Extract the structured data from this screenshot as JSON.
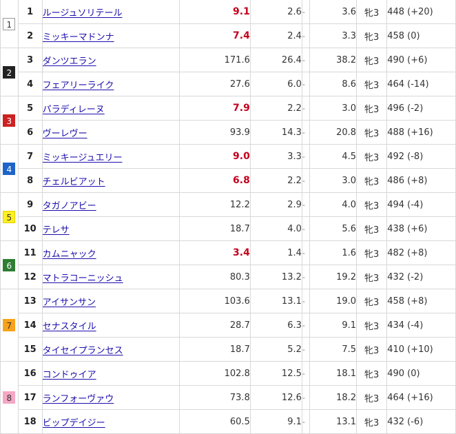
{
  "waku": [
    {
      "label": "1",
      "bg": "#ffffff",
      "fg": "#333333",
      "border": "#999999"
    },
    {
      "label": "2",
      "bg": "#222222",
      "fg": "#ffffff",
      "border": "#222222"
    },
    {
      "label": "3",
      "bg": "#cc2222",
      "fg": "#ffffff",
      "border": "#cc2222"
    },
    {
      "label": "4",
      "bg": "#1e64c8",
      "fg": "#ffffff",
      "border": "#1e64c8"
    },
    {
      "label": "5",
      "bg": "#ffee22",
      "fg": "#333333",
      "border": "#e0d000"
    },
    {
      "label": "6",
      "bg": "#2e7d32",
      "fg": "#ffffff",
      "border": "#2e7d32"
    },
    {
      "label": "7",
      "bg": "#f7a21b",
      "fg": "#333333",
      "border": "#f7a21b"
    },
    {
      "label": "8",
      "bg": "#f5a7c4",
      "fg": "#333333",
      "border": "#f5a7c4"
    }
  ],
  "rows": [
    {
      "umaban": "1",
      "name": "ルージュソリテール",
      "win": "9.1",
      "hot": true,
      "place_low": "2.6",
      "dash": "-",
      "place_high": "3.6",
      "sex_age": "牝3",
      "weight": "448 (+20)"
    },
    {
      "umaban": "2",
      "name": "ミッキーマドンナ",
      "win": "7.4",
      "hot": true,
      "place_low": "2.4",
      "dash": "-",
      "place_high": "3.3",
      "sex_age": "牝3",
      "weight": "458 (0)"
    },
    {
      "umaban": "3",
      "name": "ダンツエラン",
      "win": "171.6",
      "hot": false,
      "place_low": "26.4",
      "dash": "-",
      "place_high": "38.2",
      "sex_age": "牝3",
      "weight": "490 (+6)"
    },
    {
      "umaban": "4",
      "name": "フェアリーライク",
      "win": "27.6",
      "hot": false,
      "place_low": "6.0",
      "dash": "-",
      "place_high": "8.6",
      "sex_age": "牝3",
      "weight": "464 (-14)"
    },
    {
      "umaban": "5",
      "name": "パラディレーヌ",
      "win": "7.9",
      "hot": true,
      "place_low": "2.2",
      "dash": "-",
      "place_high": "3.0",
      "sex_age": "牝3",
      "weight": "496 (-2)"
    },
    {
      "umaban": "6",
      "name": "ヴーレヴー",
      "win": "93.9",
      "hot": false,
      "place_low": "14.3",
      "dash": "-",
      "place_high": "20.8",
      "sex_age": "牝3",
      "weight": "488 (+16)"
    },
    {
      "umaban": "7",
      "name": "ミッキージュエリー",
      "win": "9.0",
      "hot": true,
      "place_low": "3.3",
      "dash": "-",
      "place_high": "4.5",
      "sex_age": "牝3",
      "weight": "492 (-8)"
    },
    {
      "umaban": "8",
      "name": "チェルビアット",
      "win": "6.8",
      "hot": true,
      "place_low": "2.2",
      "dash": "-",
      "place_high": "3.0",
      "sex_age": "牝3",
      "weight": "486 (+8)"
    },
    {
      "umaban": "9",
      "name": "タガノアビー",
      "win": "12.2",
      "hot": false,
      "place_low": "2.9",
      "dash": "-",
      "place_high": "4.0",
      "sex_age": "牝3",
      "weight": "494 (-4)"
    },
    {
      "umaban": "10",
      "name": "テレサ",
      "win": "18.7",
      "hot": false,
      "place_low": "4.0",
      "dash": "-",
      "place_high": "5.6",
      "sex_age": "牝3",
      "weight": "438 (+6)"
    },
    {
      "umaban": "11",
      "name": "カムニャック",
      "win": "3.4",
      "hot": true,
      "place_low": "1.4",
      "dash": "-",
      "place_high": "1.6",
      "sex_age": "牝3",
      "weight": "482 (+8)"
    },
    {
      "umaban": "12",
      "name": "マトラコーニッシュ",
      "win": "80.3",
      "hot": false,
      "place_low": "13.2",
      "dash": "-",
      "place_high": "19.2",
      "sex_age": "牝3",
      "weight": "432 (-2)"
    },
    {
      "umaban": "13",
      "name": "アイサンサン",
      "win": "103.6",
      "hot": false,
      "place_low": "13.1",
      "dash": "-",
      "place_high": "19.0",
      "sex_age": "牝3",
      "weight": "458 (+8)"
    },
    {
      "umaban": "14",
      "name": "セナスタイル",
      "win": "28.7",
      "hot": false,
      "place_low": "6.3",
      "dash": "-",
      "place_high": "9.1",
      "sex_age": "牝3",
      "weight": "434 (-4)"
    },
    {
      "umaban": "15",
      "name": "タイセイプランセス",
      "win": "18.7",
      "hot": false,
      "place_low": "5.2",
      "dash": "-",
      "place_high": "7.5",
      "sex_age": "牝3",
      "weight": "410 (+10)"
    },
    {
      "umaban": "16",
      "name": "コンドゥイア",
      "win": "102.8",
      "hot": false,
      "place_low": "12.5",
      "dash": "-",
      "place_high": "18.1",
      "sex_age": "牝3",
      "weight": "490 (0)"
    },
    {
      "umaban": "17",
      "name": "ランフォーヴァウ",
      "win": "73.8",
      "hot": false,
      "place_low": "12.6",
      "dash": "-",
      "place_high": "18.2",
      "sex_age": "牝3",
      "weight": "464 (+16)"
    },
    {
      "umaban": "18",
      "name": "ビップデイジー",
      "win": "60.5",
      "hot": false,
      "place_low": "9.1",
      "dash": "-",
      "place_high": "13.1",
      "sex_age": "牝3",
      "weight": "432 (-6)"
    }
  ]
}
